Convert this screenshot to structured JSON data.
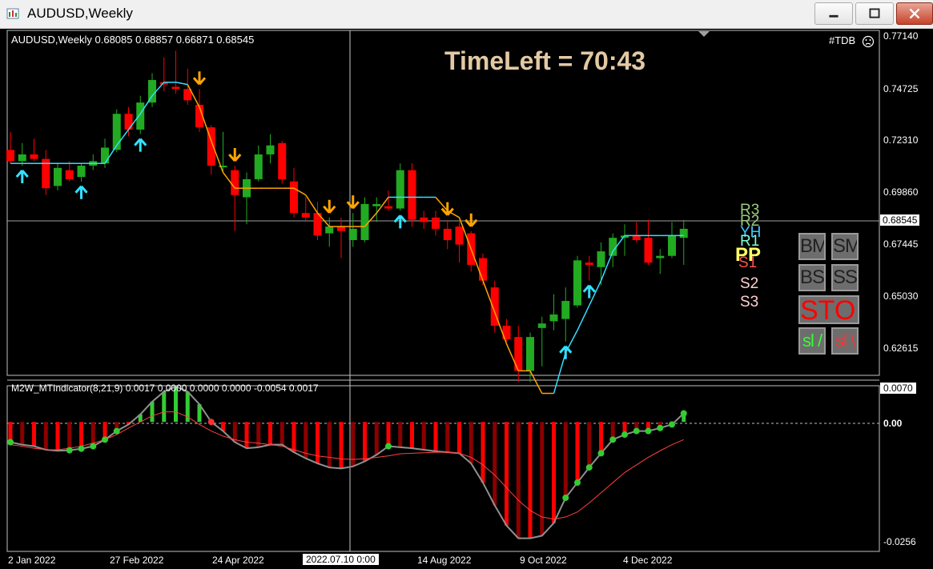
{
  "window": {
    "title": "AUDUSD,Weekly"
  },
  "chart_header": {
    "symbol_info": "AUDUSD,Weekly  0.68085 0.68857 0.66871 0.68545",
    "tdb_label": "#TDB",
    "time_left": "TimeLeft = 70:43"
  },
  "price_axis": {
    "labels": [
      "0.77140",
      "0.74725",
      "0.72310",
      "0.69860",
      "0.67445",
      "0.65030",
      "0.62615"
    ],
    "current_price": "0.68545"
  },
  "indicator": {
    "title": "M2W_MTIndicator(8,21,9) 0.0017 0.0000 0.0000 0.0000 -0.0054 0.0017",
    "axis_labels": {
      "top": "0.0070",
      "zero": "0.00",
      "bottom": "-0.0256"
    }
  },
  "time_axis": {
    "labels": [
      "2 Jan 2022",
      "27 Feb 2022",
      "24 Apr 2022",
      "14 Aug 2022",
      "9 Oct 2022",
      "4 Dec 2022"
    ],
    "crosshair_label": "2022.07.10 0:00"
  },
  "pivots": {
    "r3": "R3",
    "r2": "R2",
    "yh": "YH",
    "r1": "R1",
    "pp": "PP",
    "s1": "S1",
    "s2": "S2",
    "s3": "S3",
    "colors": {
      "r3": "#9acd7a",
      "r2": "#9acd7a",
      "yh": "#40c8ff",
      "r1": "#7fffd4",
      "pp": "#ffff66",
      "s1": "#ff6060",
      "s2": "#ffc8c8",
      "s3": "#ffc8c8"
    }
  },
  "control_buttons": {
    "bm": "BM",
    "sm": "SM",
    "bs": "BS",
    "ss": "SS",
    "stop": "STOP",
    "sl_up": "sl /",
    "sl_down": "sl \\"
  },
  "colors": {
    "bull": "#22aa22",
    "bear": "#ff0000",
    "supertrend_up": "#33e0ff",
    "supertrend_down": "#ffa500",
    "hist_neg": "#ff0000",
    "hist_neg_dark": "#8b0000",
    "hist_pos": "#33cc33"
  },
  "chart_data": {
    "type": "candlestick",
    "title": "AUDUSD,Weekly",
    "ylim": [
      0.62,
      0.773
    ],
    "candles": [
      {
        "o": 0.72,
        "h": 0.728,
        "l": 0.714,
        "c": 0.715
      },
      {
        "o": 0.715,
        "h": 0.723,
        "l": 0.713,
        "c": 0.718
      },
      {
        "o": 0.718,
        "h": 0.725,
        "l": 0.715,
        "c": 0.716
      },
      {
        "o": 0.716,
        "h": 0.72,
        "l": 0.7,
        "c": 0.703
      },
      {
        "o": 0.704,
        "h": 0.714,
        "l": 0.702,
        "c": 0.712
      },
      {
        "o": 0.711,
        "h": 0.715,
        "l": 0.706,
        "c": 0.707
      },
      {
        "o": 0.708,
        "h": 0.714,
        "l": 0.706,
        "c": 0.713
      },
      {
        "o": 0.713,
        "h": 0.718,
        "l": 0.711,
        "c": 0.715
      },
      {
        "o": 0.714,
        "h": 0.725,
        "l": 0.712,
        "c": 0.721
      },
      {
        "o": 0.72,
        "h": 0.738,
        "l": 0.719,
        "c": 0.736
      },
      {
        "o": 0.736,
        "h": 0.739,
        "l": 0.726,
        "c": 0.729
      },
      {
        "o": 0.729,
        "h": 0.744,
        "l": 0.727,
        "c": 0.741
      },
      {
        "o": 0.741,
        "h": 0.754,
        "l": 0.739,
        "c": 0.751
      },
      {
        "o": 0.75,
        "h": 0.761,
        "l": 0.746,
        "c": 0.749
      },
      {
        "o": 0.748,
        "h": 0.764,
        "l": 0.745,
        "c": 0.747
      },
      {
        "o": 0.747,
        "h": 0.756,
        "l": 0.74,
        "c": 0.742
      },
      {
        "o": 0.74,
        "h": 0.747,
        "l": 0.728,
        "c": 0.73
      },
      {
        "o": 0.73,
        "h": 0.731,
        "l": 0.709,
        "c": 0.713
      },
      {
        "o": 0.713,
        "h": 0.728,
        "l": 0.71,
        "c": 0.713
      },
      {
        "o": 0.711,
        "h": 0.713,
        "l": 0.684,
        "c": 0.7
      },
      {
        "o": 0.699,
        "h": 0.71,
        "l": 0.687,
        "c": 0.707
      },
      {
        "o": 0.707,
        "h": 0.722,
        "l": 0.706,
        "c": 0.718
      },
      {
        "o": 0.718,
        "h": 0.727,
        "l": 0.714,
        "c": 0.722
      },
      {
        "o": 0.723,
        "h": 0.724,
        "l": 0.705,
        "c": 0.707
      },
      {
        "o": 0.706,
        "h": 0.712,
        "l": 0.69,
        "c": 0.692
      },
      {
        "o": 0.692,
        "h": 0.699,
        "l": 0.688,
        "c": 0.69
      },
      {
        "o": 0.692,
        "h": 0.697,
        "l": 0.68,
        "c": 0.682
      },
      {
        "o": 0.683,
        "h": 0.69,
        "l": 0.677,
        "c": 0.686
      },
      {
        "o": 0.686,
        "h": 0.69,
        "l": 0.672,
        "c": 0.684
      },
      {
        "o": 0.68,
        "h": 0.692,
        "l": 0.677,
        "c": 0.685
      },
      {
        "o": 0.68,
        "h": 0.699,
        "l": 0.679,
        "c": 0.696
      },
      {
        "o": 0.695,
        "h": 0.699,
        "l": 0.688,
        "c": 0.696
      },
      {
        "o": 0.695,
        "h": 0.702,
        "l": 0.693,
        "c": 0.694
      },
      {
        "o": 0.694,
        "h": 0.714,
        "l": 0.693,
        "c": 0.711
      },
      {
        "o": 0.711,
        "h": 0.714,
        "l": 0.686,
        "c": 0.689
      },
      {
        "o": 0.69,
        "h": 0.693,
        "l": 0.685,
        "c": 0.688
      },
      {
        "o": 0.69,
        "h": 0.693,
        "l": 0.682,
        "c": 0.685
      },
      {
        "o": 0.685,
        "h": 0.689,
        "l": 0.676,
        "c": 0.68
      },
      {
        "o": 0.686,
        "h": 0.688,
        "l": 0.67,
        "c": 0.678
      },
      {
        "o": 0.683,
        "h": 0.684,
        "l": 0.666,
        "c": 0.669
      },
      {
        "o": 0.672,
        "h": 0.674,
        "l": 0.66,
        "c": 0.662
      },
      {
        "o": 0.659,
        "h": 0.662,
        "l": 0.639,
        "c": 0.642
      },
      {
        "o": 0.642,
        "h": 0.645,
        "l": 0.635,
        "c": 0.636
      },
      {
        "o": 0.637,
        "h": 0.642,
        "l": 0.617,
        "c": 0.622
      },
      {
        "o": 0.622,
        "h": 0.639,
        "l": 0.617,
        "c": 0.637
      },
      {
        "o": 0.641,
        "h": 0.646,
        "l": 0.624,
        "c": 0.643
      },
      {
        "o": 0.644,
        "h": 0.656,
        "l": 0.64,
        "c": 0.647
      },
      {
        "o": 0.645,
        "h": 0.659,
        "l": 0.635,
        "c": 0.653
      },
      {
        "o": 0.651,
        "h": 0.673,
        "l": 0.65,
        "c": 0.671
      },
      {
        "o": 0.67,
        "h": 0.673,
        "l": 0.662,
        "c": 0.669
      },
      {
        "o": 0.668,
        "h": 0.679,
        "l": 0.66,
        "c": 0.675
      },
      {
        "o": 0.673,
        "h": 0.683,
        "l": 0.668,
        "c": 0.681
      },
      {
        "o": 0.681,
        "h": 0.687,
        "l": 0.673,
        "c": 0.682
      },
      {
        "o": 0.682,
        "h": 0.688,
        "l": 0.679,
        "c": 0.68
      },
      {
        "o": 0.681,
        "h": 0.689,
        "l": 0.669,
        "c": 0.67
      },
      {
        "o": 0.672,
        "h": 0.676,
        "l": 0.665,
        "c": 0.673
      },
      {
        "o": 0.673,
        "h": 0.688,
        "l": 0.672,
        "c": 0.682
      },
      {
        "o": 0.681,
        "h": 0.689,
        "l": 0.669,
        "c": 0.685
      }
    ],
    "supertrend": [
      0.714,
      0.714,
      0.714,
      0.714,
      0.714,
      0.714,
      0.714,
      0.714,
      0.714,
      0.722,
      0.729,
      0.736,
      0.744,
      0.75,
      0.75,
      0.749,
      0.739,
      0.724,
      0.71,
      0.703,
      0.703,
      0.703,
      0.703,
      0.703,
      0.703,
      0.7,
      0.692,
      0.686,
      0.686,
      0.686,
      0.686,
      0.692,
      0.699,
      0.699,
      0.699,
      0.699,
      0.699,
      0.693,
      0.69,
      0.676,
      0.662,
      0.648,
      0.634,
      0.622,
      0.622,
      0.612,
      0.612,
      0.63,
      0.64,
      0.651,
      0.662,
      0.675,
      0.682,
      0.682,
      0.682,
      0.682,
      0.682,
      0.682
    ],
    "indicator_series": {
      "ylim": [
        -0.0256,
        0.007
      ],
      "histogram": [
        -0.004,
        -0.0045,
        -0.0048,
        -0.0055,
        -0.0057,
        -0.0056,
        -0.0053,
        -0.0048,
        -0.0035,
        -0.0018,
        -0.0005,
        0.0015,
        0.004,
        0.006,
        0.007,
        0.006,
        0.0035,
        0.0,
        -0.0018,
        -0.004,
        -0.0052,
        -0.005,
        -0.0045,
        -0.0045,
        -0.006,
        -0.0072,
        -0.0082,
        -0.009,
        -0.0092,
        -0.0088,
        -0.0078,
        -0.0065,
        -0.0048,
        -0.005,
        -0.0052,
        -0.0055,
        -0.0058,
        -0.006,
        -0.0062,
        -0.0082,
        -0.012,
        -0.0165,
        -0.0205,
        -0.023,
        -0.023,
        -0.0225,
        -0.02,
        -0.015,
        -0.012,
        -0.009,
        -0.0062,
        -0.0035,
        -0.0025,
        -0.0018,
        -0.0018,
        -0.0012,
        -0.0005,
        0.0017
      ],
      "signal": [
        -0.0045,
        -0.0048,
        -0.0052,
        -0.0055,
        -0.0055,
        -0.0052,
        -0.0048,
        -0.0042,
        -0.0035,
        -0.0025,
        -0.0012,
        0.0,
        0.0012,
        0.002,
        0.002,
        0.001,
        -0.0005,
        -0.0018,
        -0.0028,
        -0.0035,
        -0.004,
        -0.0042,
        -0.0045,
        -0.0048,
        -0.0055,
        -0.0062,
        -0.0067,
        -0.007,
        -0.0073,
        -0.0074,
        -0.0073,
        -0.007,
        -0.0067,
        -0.0063,
        -0.0062,
        -0.0061,
        -0.006,
        -0.006,
        -0.0062,
        -0.007,
        -0.0085,
        -0.0105,
        -0.013,
        -0.0155,
        -0.0175,
        -0.0188,
        -0.0192,
        -0.0188,
        -0.0178,
        -0.016,
        -0.014,
        -0.012,
        -0.01,
        -0.0085,
        -0.007,
        -0.0057,
        -0.0045,
        -0.0035
      ]
    }
  }
}
